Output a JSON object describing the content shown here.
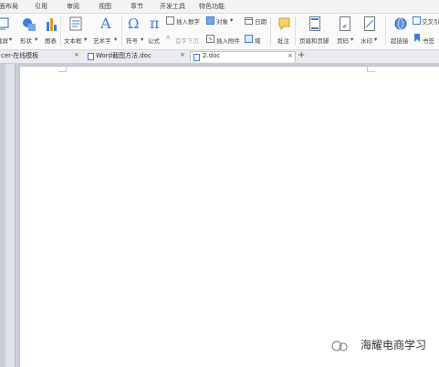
{
  "menu": {
    "tabs": [
      "页面布局",
      "引用",
      "审阅",
      "视图",
      "章节",
      "开发工具",
      "特色功能"
    ]
  },
  "ribbon": {
    "screenshot": "截屏",
    "shapes": "形状",
    "chart": "图表",
    "textbox": "文本框",
    "wordart": "艺术字",
    "symbol": "符号",
    "formula": "公式",
    "insert_number": "插入数字",
    "object": "对象",
    "date": "日期",
    "first_letter": "首字下沉",
    "insert_attachment": "插入附件",
    "field": "域",
    "comment": "批注",
    "header_footer": "页眉和页脚",
    "page_number": "页码",
    "watermark": "水印",
    "hyperlink": "超链接",
    "cross_ref": "交叉引",
    "bookmark": "书签"
  },
  "doc_tabs": [
    {
      "label": "cer-在线模板",
      "active": false
    },
    {
      "label": "Word截图方法.doc",
      "active": false
    },
    {
      "label": "2.doc",
      "active": true
    }
  ],
  "watermark_text": "海耀电商学习",
  "colors": {
    "accent_blue": "#3d7fd6",
    "workspace": "#c9ced6",
    "page": "#ffffff"
  }
}
